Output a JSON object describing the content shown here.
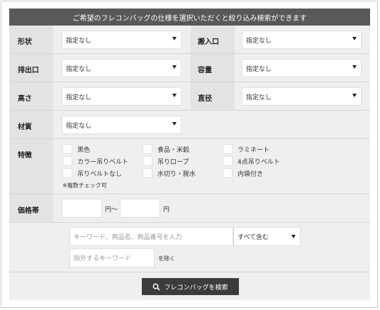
{
  "header": {
    "text": "ご希望のフレコンバッグの仕様を選択いただくと絞り込み検索ができます"
  },
  "fields": {
    "shape": {
      "label": "形状",
      "value": "指定なし"
    },
    "inlet": {
      "label": "搬入口",
      "value": "指定なし"
    },
    "outlet": {
      "label": "排出口",
      "value": "指定なし"
    },
    "capacity": {
      "label": "容量",
      "value": "指定なし"
    },
    "height": {
      "label": "高さ",
      "value": "指定なし"
    },
    "diameter": {
      "label": "直径",
      "value": "指定なし"
    },
    "material": {
      "label": "材質",
      "value": "指定なし"
    }
  },
  "features": {
    "label": "特徴",
    "options": [
      "黒色",
      "食品・米穀",
      "ラミネート",
      "カラー吊りベルト",
      "吊りロープ",
      "4点吊りベルト",
      "吊りベルトなし",
      "水切り・脱水",
      "内袋付き"
    ],
    "note": "※複数チェック可"
  },
  "price": {
    "label": "価格帯",
    "unit_from": "円〜",
    "unit_to": "円",
    "min_value": "",
    "max_value": ""
  },
  "keyword": {
    "placeholder": "キーワード、商品名、商品番号を入力",
    "match_value": "すべて含む",
    "exclude_placeholder": "除外するキーワード",
    "exclude_suffix": "を除く"
  },
  "search_button": {
    "label": "フレコンバッグを検索"
  }
}
